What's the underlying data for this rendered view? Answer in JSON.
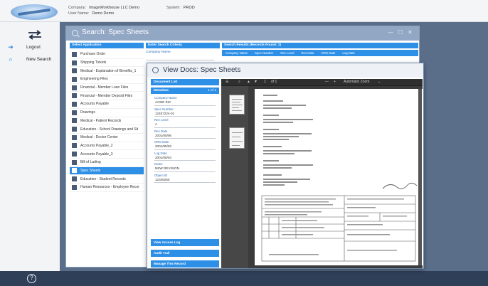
{
  "header": {
    "company_label": "Company:",
    "company_value": "ImageWorkhouse LLC Demo",
    "username_label": "User Name:",
    "username_value": "Demo Demo",
    "system_label": "System:",
    "system_value": "PROD"
  },
  "nav": {
    "logout": "Logout",
    "new_search": "New Search"
  },
  "search": {
    "title": "Search: Spec Sheets",
    "select_application": "Select Application",
    "enter_criteria": "Enter Search Criteria",
    "company_name_label": "Company Name",
    "results_header": "Search Results (Records Found: 1)",
    "result_columns": [
      "Company Name",
      "Spec Number",
      "Rev Level",
      "Rev Date",
      "ORG Date",
      "Log Date"
    ],
    "applications": [
      "Purchase Order",
      "Shipping Tickets",
      "Medical - Explanation of Benefits_1",
      "Engineering Files",
      "Financial - Member Loan Files",
      "Financial - Member Deposit Files",
      "Accounts Payable",
      "Drawings",
      "Medical - Patient Records",
      "Education - School Drawings and Sit",
      "Medical - Doctor Center",
      "Accounts Payable_2",
      "Accounts Payable_3",
      "Bill of Lading",
      "Spec Sheets",
      "Education - Student Records",
      "Human Resources - Employee Recor"
    ],
    "selected_application": "Spec Sheets"
  },
  "docs": {
    "title": "View Docs: Spec Sheets",
    "document_list": "Document List",
    "metadata": "Metadata",
    "page_indicator": "1 of 1",
    "fields": [
      {
        "label": "Company Name",
        "value": "ACME INC"
      },
      {
        "label": "Spec Number",
        "value": "12457224-01"
      },
      {
        "label": "Rev Level",
        "value": "A"
      },
      {
        "label": "Rev Date",
        "value": "2001/05/06"
      },
      {
        "label": "ORG Date",
        "value": "2001/05/02"
      },
      {
        "label": "Log Date",
        "value": "2001/05/03"
      },
      {
        "label": "Notes",
        "value": "NEW REVISION"
      },
      {
        "label": "Object ID",
        "value": "12346250"
      }
    ],
    "view_access_log": "View Access Log",
    "audit_trail": "Audit Trail",
    "manage_record": "Manage This Record",
    "viewer_page_count": "of 1",
    "viewer_zoom": "Automatic Zoom"
  }
}
